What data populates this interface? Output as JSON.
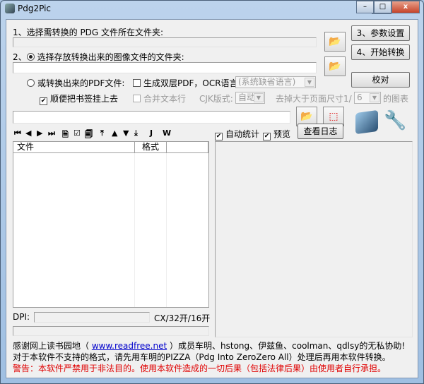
{
  "window": {
    "title": "Pdg2Pic",
    "minimize": "–",
    "maximize": "□",
    "close": "x"
  },
  "step1": {
    "label": "1、选择需转换的 PDG 文件所在文件夹:",
    "value": ""
  },
  "step2": {
    "label": "2、",
    "radio_label": "选择存放转换出来的图像文件的文件夹:",
    "value": ""
  },
  "buttons": {
    "settings": "3、参数设置",
    "start": "4、开始转换",
    "proofread": "校对",
    "view_log": "查看日志"
  },
  "pdf": {
    "radio_label": "或转换出来的PDF文件:",
    "dual_layer_label": "生成双层PDF，OCR语言:",
    "ocr_language": "(系统缺省语言)",
    "bookmark_label": "顺便把书签挂上去",
    "bookmark_checked": true,
    "merge_label": "合并文本行",
    "cjk_label": "CJK版式:",
    "cjk_value": "自动",
    "remove_label": "去掉大于页面尺寸1/",
    "remove_value": "6",
    "remove_suffix": "的图表",
    "path": ""
  },
  "toolbar": {
    "icons": [
      "first-icon",
      "prev-icon",
      "next-icon",
      "last-icon",
      "doc-icon",
      "check-icon",
      "copy-icon",
      "top-icon",
      "up-icon",
      "down-icon",
      "bottom-icon",
      "j-icon",
      "w-icon"
    ],
    "glyphs": [
      "⏮",
      "◀",
      "▶",
      "⏭",
      "🗎",
      "☑",
      "🗐",
      "⤒",
      "▲",
      "▼",
      "⤓",
      "J",
      "W"
    ]
  },
  "options": {
    "auto_stats": "自动统计",
    "auto_stats_checked": true,
    "preview": "预览",
    "preview_checked": true
  },
  "list": {
    "columns": [
      "文件",
      "格式",
      ""
    ]
  },
  "dpi": {
    "label": "DPI:",
    "value": "",
    "format": "CX/32开/16开"
  },
  "footer": {
    "thanks_prefix": "感谢网上读书园地（ ",
    "link": "www.readfree.net",
    "thanks_suffix": " ）成员车明、hstong、伊兹鱼、coolman、qdlsy的无私协助!",
    "note": "对于本软件不支持的格式，请先用车明的PIZZA（Pdg Into ZeroZero All）处理后再用本软件转换。",
    "warning": "警告：本软件严禁用于非法目的。使用本软件造成的一切后果（包括法律后果）由使用者自行承担。"
  },
  "colors": {
    "warning": "#e00000",
    "link": "#0000cc"
  }
}
